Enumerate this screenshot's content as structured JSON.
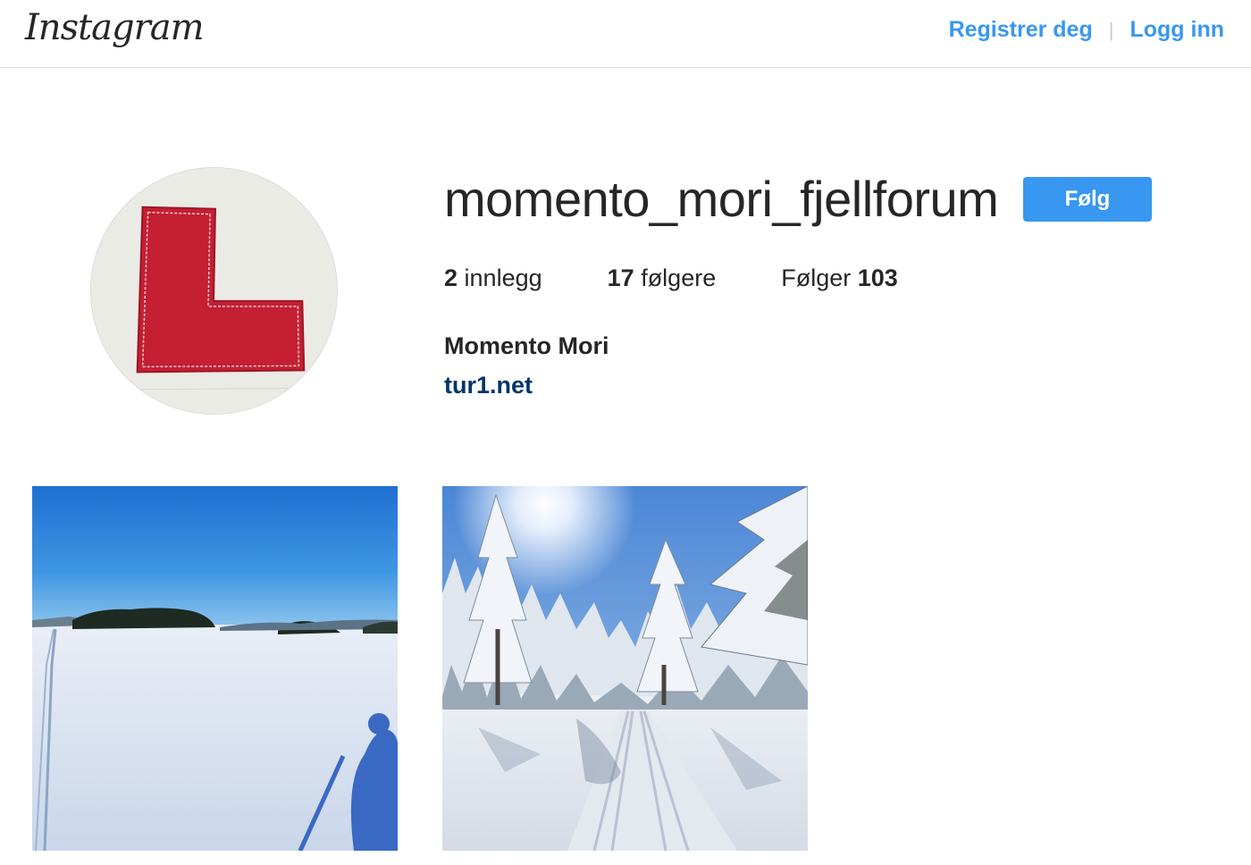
{
  "header": {
    "logo_text": "Instagram",
    "signup_label": "Registrer deg",
    "login_label": "Logg inn",
    "accent_color": "#3897f0"
  },
  "profile": {
    "username": "momento_mori_fjellforum",
    "follow_label": "Følg",
    "posts_count": "2",
    "posts_label": "innlegg",
    "followers_count": "17",
    "followers_label": "følgere",
    "following_label": "Følger",
    "following_count": "103",
    "full_name": "Momento Mori",
    "website": "tur1.net",
    "link_color": "#003569"
  },
  "posts": [
    {
      "icon": "winter-lake-photo"
    },
    {
      "icon": "snowy-forest-trail-photo"
    }
  ]
}
